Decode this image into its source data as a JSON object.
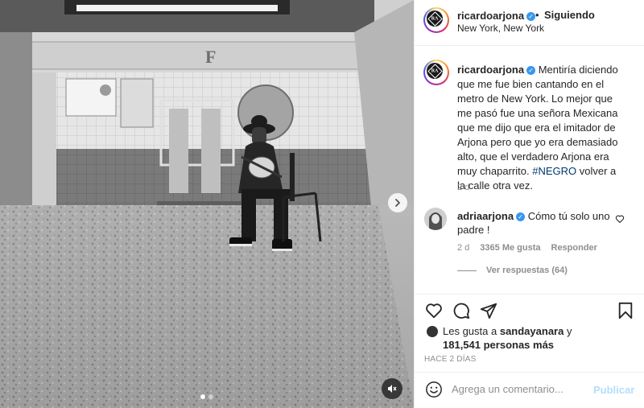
{
  "post": {
    "username": "ricardoarjona",
    "follow_sep": "•",
    "follow_status": "Siguiendo",
    "location": "New York, New York",
    "caption_pre": "Mentiría diciendo que me fue bien cantando en el metro de New York. Lo mejor que me pasó fue una señora Mexicana que me dijo que era el imitador de Arjona pero que yo era demasiado alto, que el verdadero Arjona era muy chaparrito.",
    "caption_tag": "#NEGRO",
    "caption_post": "volver a la calle otra vez.",
    "caption_time": "2 d"
  },
  "comment": {
    "username": "adriaarjona",
    "text": "Cómo tú solo uno padre !",
    "time": "2 d",
    "likes": "3365 Me gusta",
    "reply": "Responder",
    "view_replies": "Ver respuestas (64)"
  },
  "likes": {
    "prefix": "Les gusta a",
    "user": "sandayanara",
    "connector": "y",
    "count": "181,541 personas más"
  },
  "post_date": "HACE 2 DÍAS",
  "comment_box": {
    "placeholder": "Agrega un comentario...",
    "publish": "Publicar"
  },
  "carousel": {
    "index": 1,
    "total": 2
  },
  "colors": {
    "verified": "#3897f0",
    "hashtag": "#00376b",
    "publish_disabled": "#b2dffc"
  },
  "icons": [
    "chevron-right-icon",
    "mute-icon",
    "heart-icon",
    "comment-icon",
    "share-icon",
    "bookmark-icon",
    "emoji-icon",
    "verified-icon"
  ]
}
